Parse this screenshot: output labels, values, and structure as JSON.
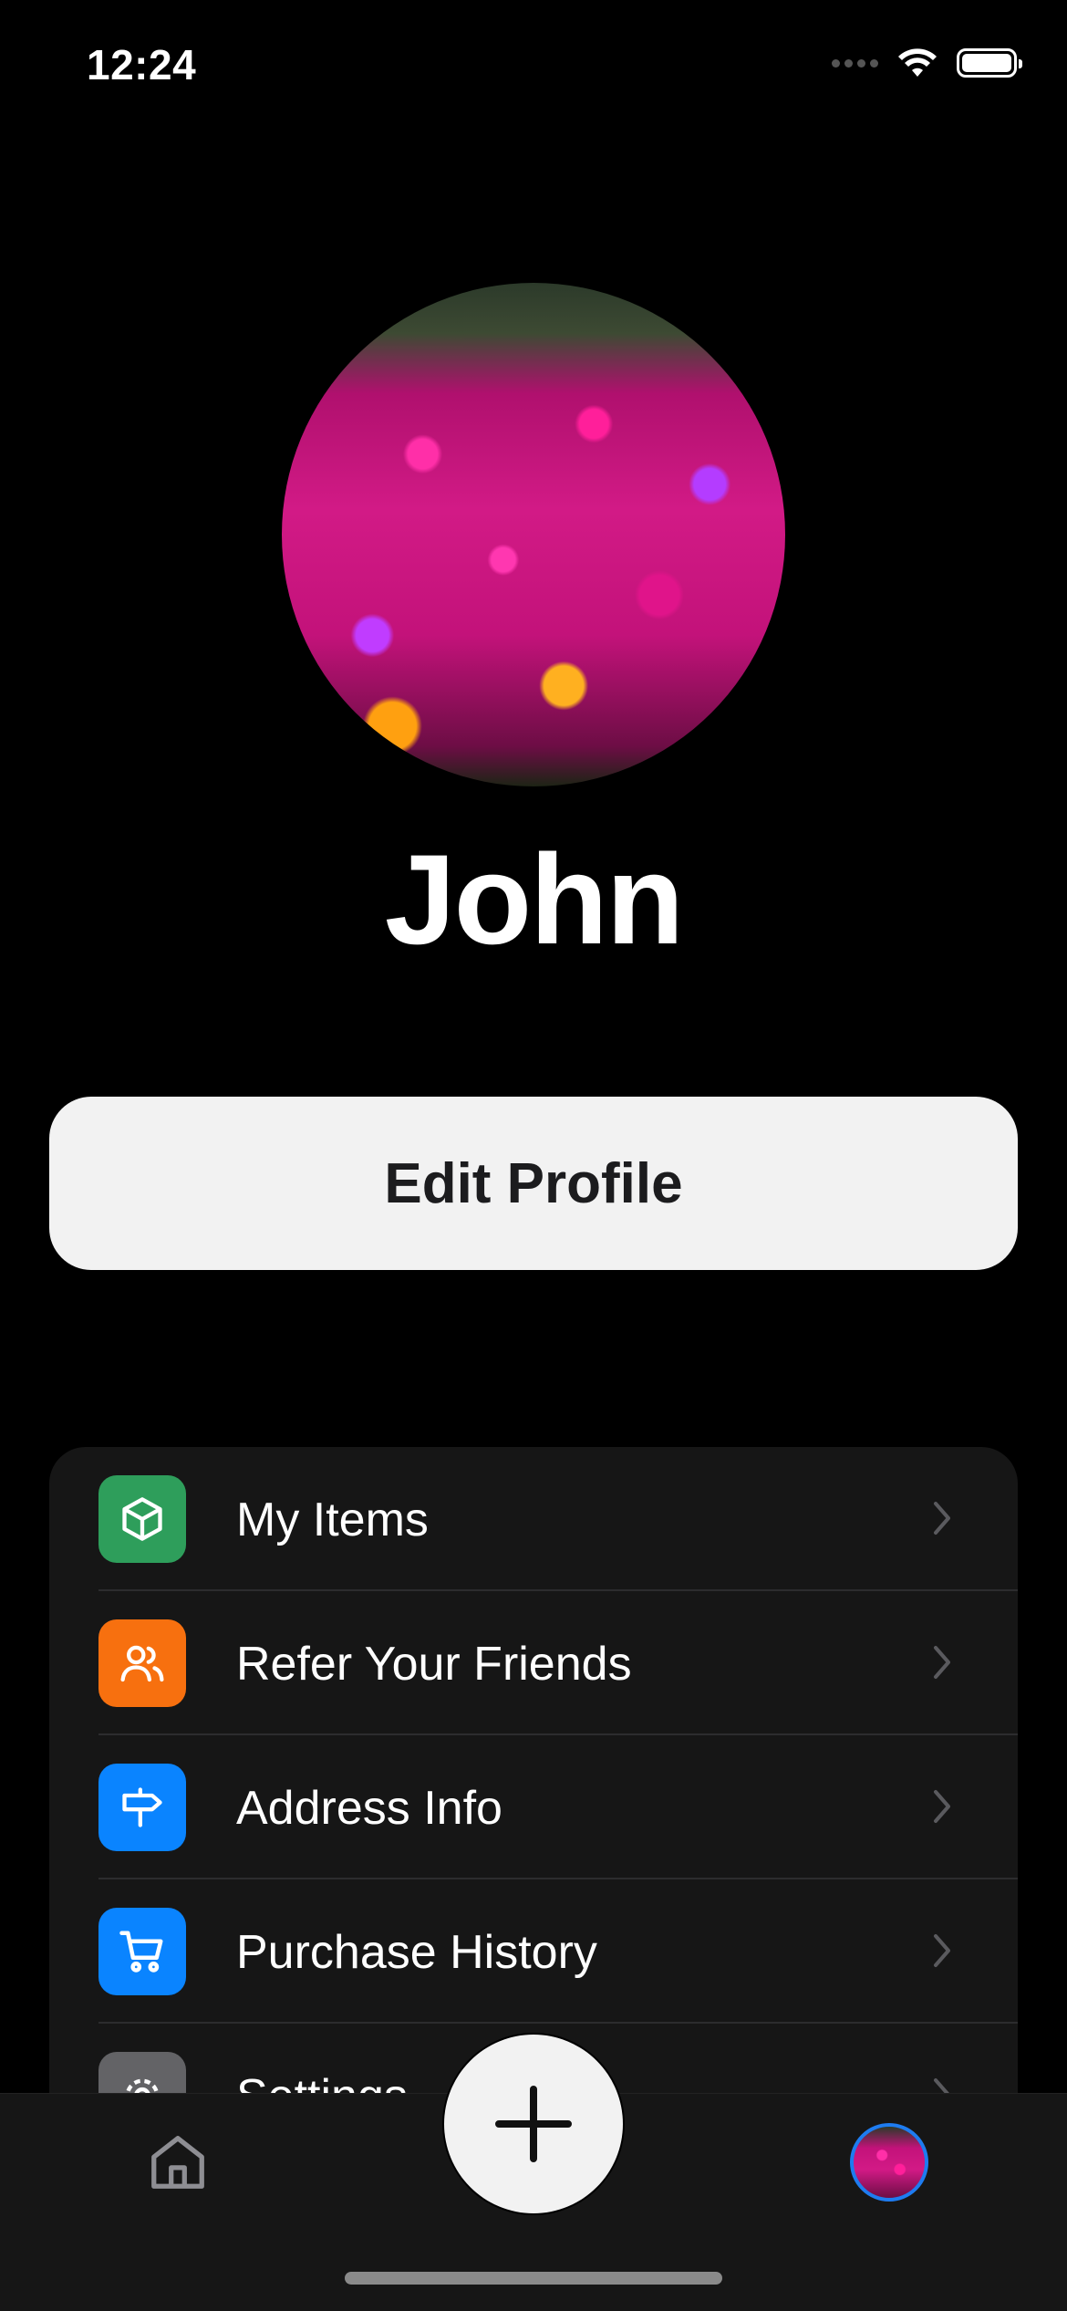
{
  "status_bar": {
    "time": "12:24"
  },
  "profile": {
    "name": "John"
  },
  "actions": {
    "edit_profile_label": "Edit Profile"
  },
  "menu": {
    "items": [
      {
        "label": "My Items",
        "icon": "box-icon",
        "color": "#2e9e5b"
      },
      {
        "label": "Refer Your Friends",
        "icon": "people-icon",
        "color": "#f7700f"
      },
      {
        "label": "Address Info",
        "icon": "signpost-icon",
        "color": "#0a84ff"
      },
      {
        "label": "Purchase History",
        "icon": "cart-icon",
        "color": "#0a84ff"
      },
      {
        "label": "Settings",
        "icon": "gear-icon",
        "color": "#636366"
      }
    ]
  },
  "tab_bar": {
    "tabs": [
      "home-icon",
      "add-icon",
      "profile-avatar"
    ],
    "active_color": "#1e7cf0"
  }
}
